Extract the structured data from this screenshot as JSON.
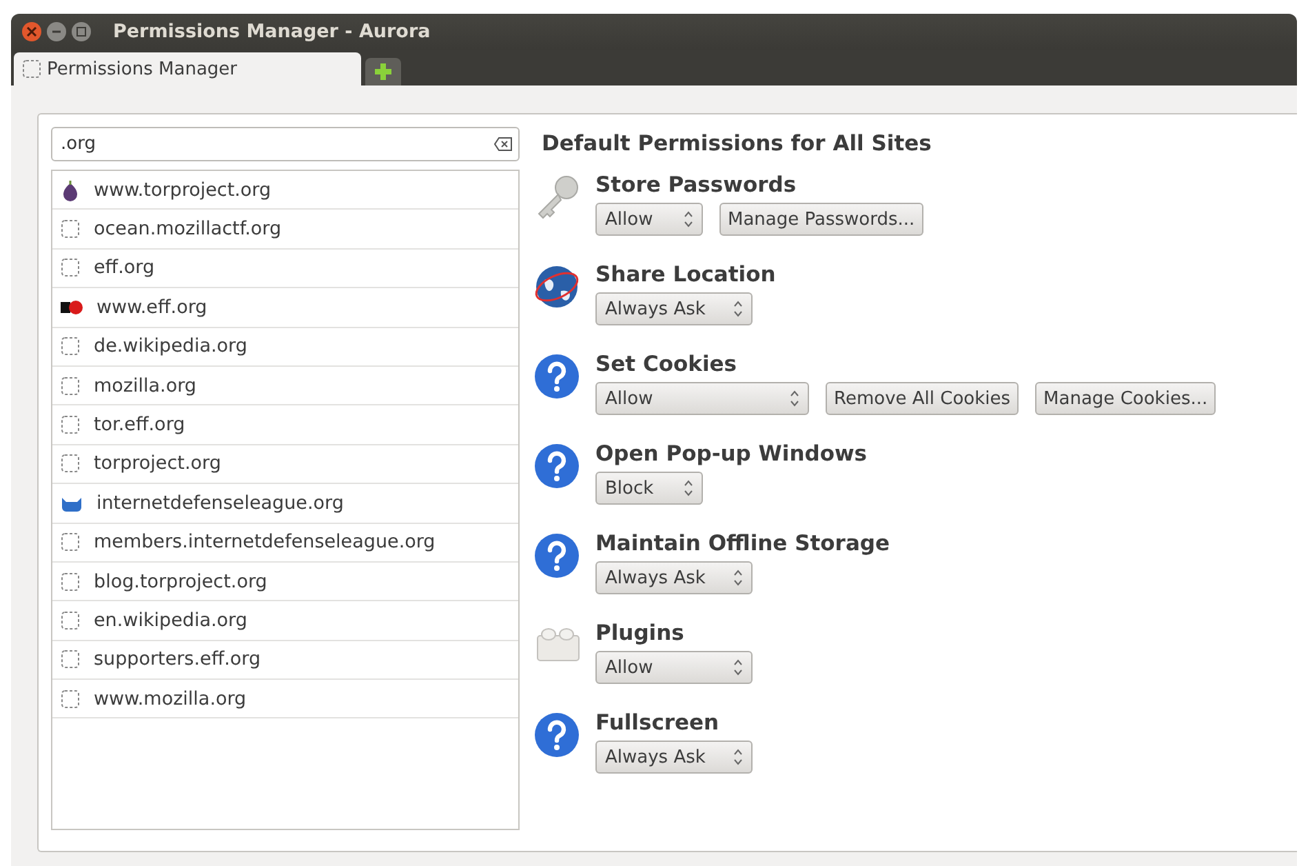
{
  "window": {
    "title": "Permissions Manager - Aurora"
  },
  "tabs": [
    {
      "label": "Permissions Manager",
      "selected": true
    }
  ],
  "search": {
    "value": ".org"
  },
  "sites": [
    {
      "name": "www.torproject.org",
      "kind": "onion"
    },
    {
      "name": "ocean.mozillactf.org",
      "kind": "blank"
    },
    {
      "name": "eff.org",
      "kind": "blank"
    },
    {
      "name": "www.eff.org",
      "kind": "eff"
    },
    {
      "name": "de.wikipedia.org",
      "kind": "blank"
    },
    {
      "name": "mozilla.org",
      "kind": "blank"
    },
    {
      "name": "tor.eff.org",
      "kind": "blank"
    },
    {
      "name": "torproject.org",
      "kind": "blank"
    },
    {
      "name": "internetdefenseleague.org",
      "kind": "cat"
    },
    {
      "name": "members.internetdefenseleague.org",
      "kind": "blank"
    },
    {
      "name": "blog.torproject.org",
      "kind": "blank"
    },
    {
      "name": "en.wikipedia.org",
      "kind": "blank"
    },
    {
      "name": "supporters.eff.org",
      "kind": "blank"
    },
    {
      "name": "www.mozilla.org",
      "kind": "blank"
    }
  ],
  "heading": "Default Permissions for All Sites",
  "permissions": [
    {
      "title": "Store Passwords",
      "kind": "key",
      "value": "Allow",
      "buttons": [
        "Manage Passwords..."
      ]
    },
    {
      "title": "Share Location",
      "kind": "globe",
      "value": "Always Ask"
    },
    {
      "title": "Set Cookies",
      "kind": "question",
      "value": "Allow",
      "buttons": [
        "Remove All Cookies",
        "Manage Cookies..."
      ]
    },
    {
      "title": "Open Pop-up Windows",
      "kind": "question",
      "value": "Block"
    },
    {
      "title": "Maintain Offline Storage",
      "kind": "question",
      "value": "Always Ask"
    },
    {
      "title": "Plugins",
      "kind": "plugin",
      "value": "Allow"
    },
    {
      "title": "Fullscreen",
      "kind": "question",
      "value": "Always Ask"
    }
  ]
}
